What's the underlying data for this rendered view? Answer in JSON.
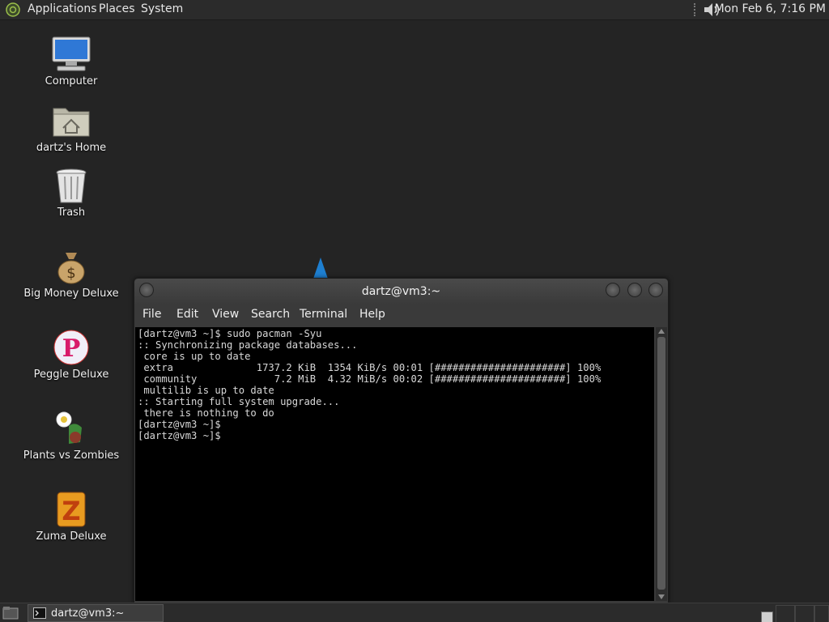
{
  "top_panel": {
    "menus": [
      "Applications",
      "Places",
      "System"
    ],
    "clock": "Mon Feb  6, 7:16 PM"
  },
  "desktop_icons": [
    {
      "label": "Computer",
      "icon": "computer-icon"
    },
    {
      "label": "dartz's Home",
      "icon": "home-folder-icon"
    },
    {
      "label": "Trash",
      "icon": "trash-icon"
    },
    {
      "label": "Big Money Deluxe",
      "icon": "money-bag-icon"
    },
    {
      "label": "Peggle Deluxe",
      "icon": "peggle-icon"
    },
    {
      "label": "Plants vs Zombies",
      "icon": "plants-vs-zombies-icon"
    },
    {
      "label": "Zuma Deluxe",
      "icon": "zuma-icon"
    }
  ],
  "terminal": {
    "title": "dartz@vm3:~",
    "menu": [
      "File",
      "Edit",
      "View",
      "Search",
      "Terminal",
      "Help"
    ],
    "lines": [
      "[dartz@vm3 ~]$ sudo pacman -Syu",
      ":: Synchronizing package databases...",
      " core is up to date",
      " extra              1737.2 KiB  1354 KiB/s 00:01 [######################] 100%",
      " community             7.2 MiB  4.32 MiB/s 00:02 [######################] 100%",
      " multilib is up to date",
      ":: Starting full system upgrade...",
      " there is nothing to do",
      "[dartz@vm3 ~]$",
      "[dartz@vm3 ~]$"
    ]
  },
  "taskbar": {
    "window_label": "dartz@vm3:~"
  }
}
